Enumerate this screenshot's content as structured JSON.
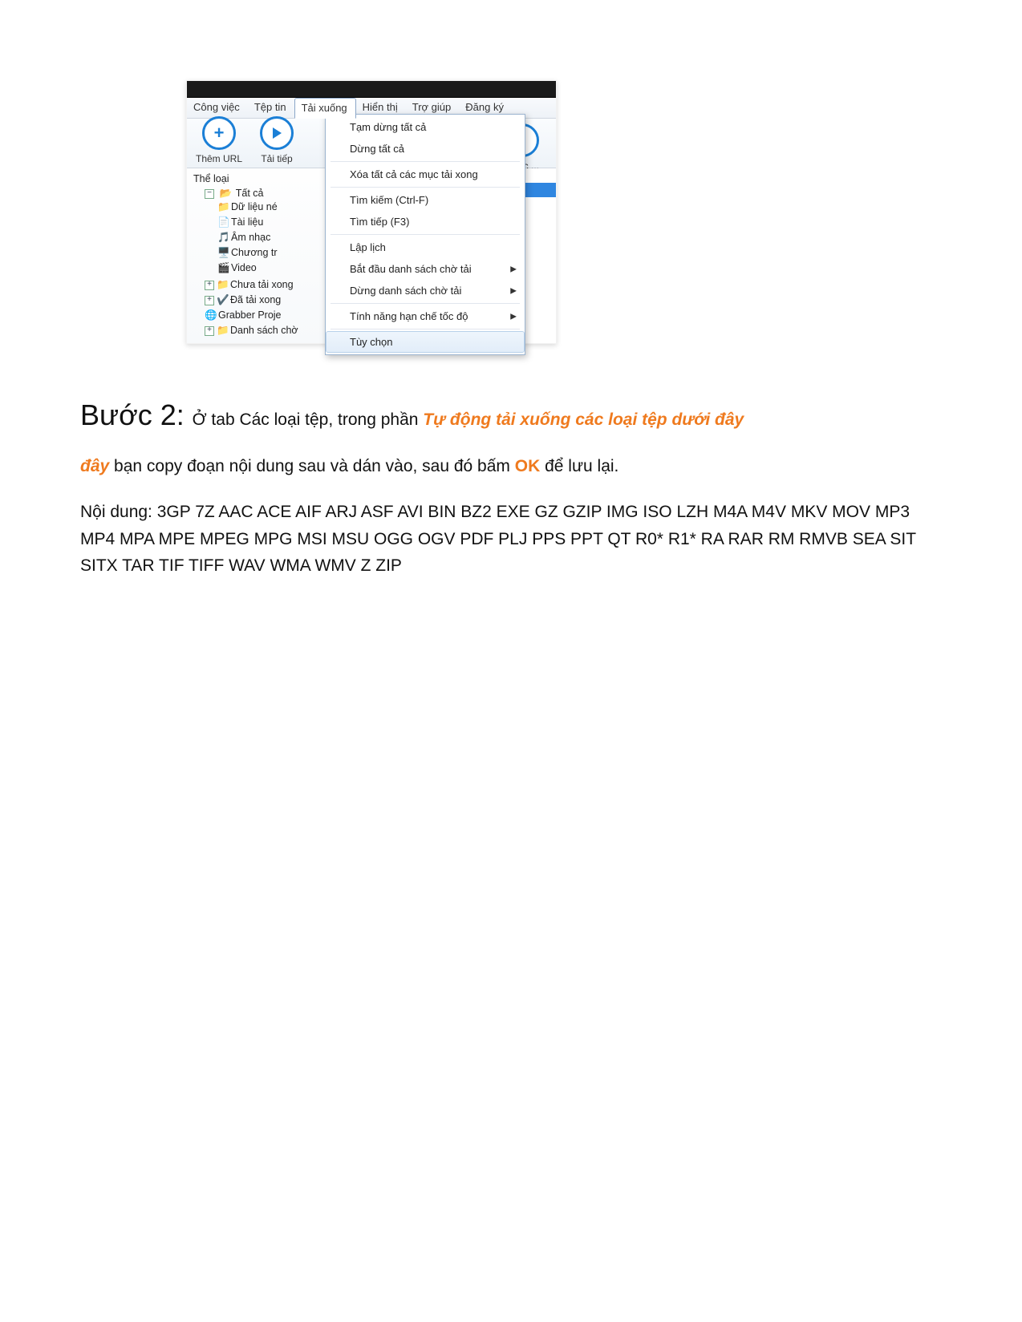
{
  "app": {
    "menubar": [
      "Công việc",
      "Tệp tin",
      "Tải xuống",
      "Hiển thị",
      "Trợ giúp",
      "Đăng ký"
    ],
    "open_menu_index": 2,
    "toolbar": {
      "add_url": "Thêm URL",
      "resume": "Tải tiếp",
      "cleanup": "a các ..."
    },
    "sidebar_title": "Thể loại",
    "tree": {
      "root": "Tất cả",
      "children": [
        "Dữ liệu né",
        "Tài liệu",
        "Âm nhạc",
        "Chương tr",
        "Video"
      ],
      "siblings": [
        "Chưa tải xong",
        "Đã tải xong",
        "Grabber Proje",
        "Danh sách chờ"
      ]
    },
    "dropdown": [
      {
        "label": "Tạm dừng tất cả"
      },
      {
        "label": "Dừng tất cả"
      },
      {
        "sep": true
      },
      {
        "label": "Xóa tất cả các mục tải xong"
      },
      {
        "sep": true
      },
      {
        "label": "Tìm kiếm (Ctrl-F)"
      },
      {
        "label": "Tìm tiếp (F3)"
      },
      {
        "sep": true
      },
      {
        "label": "Lập lịch"
      },
      {
        "label": "Bắt đầu danh sách chờ tải",
        "sub": true
      },
      {
        "label": "Dừng danh sách chờ tải",
        "sub": true
      },
      {
        "sep": true
      },
      {
        "label": "Tính năng hạn chế tốc độ",
        "sub": true
      },
      {
        "sep": true
      },
      {
        "label": "Tùy chọn",
        "hover": true
      }
    ]
  },
  "text": {
    "step_label": "Bước 2:",
    "line1_a": " Ở tab Các loại tệp, trong phần ",
    "line1_em": "Tự động tải xuống các loại tệp dưới đây",
    "line2_a": " bạn copy đoạn nội dung sau và dán vào, sau đó bấm ",
    "line2_em": "OK",
    "line2_b": " để lưu lại.",
    "content_label": "Nội dung: ",
    "content_body": "3GP 7Z AAC ACE AIF ARJ ASF AVI BIN BZ2 EXE GZ GZIP IMG ISO LZH M4A M4V MKV MOV MP3 MP4 MPA MPE MPEG MPG MSI MSU OGG OGV PDF PLJ PPS PPT QT R0* R1* RA RAR RM RMVB SEA SIT SITX TAR TIF TIFF WAV WMA WMV Z ZIP"
  }
}
